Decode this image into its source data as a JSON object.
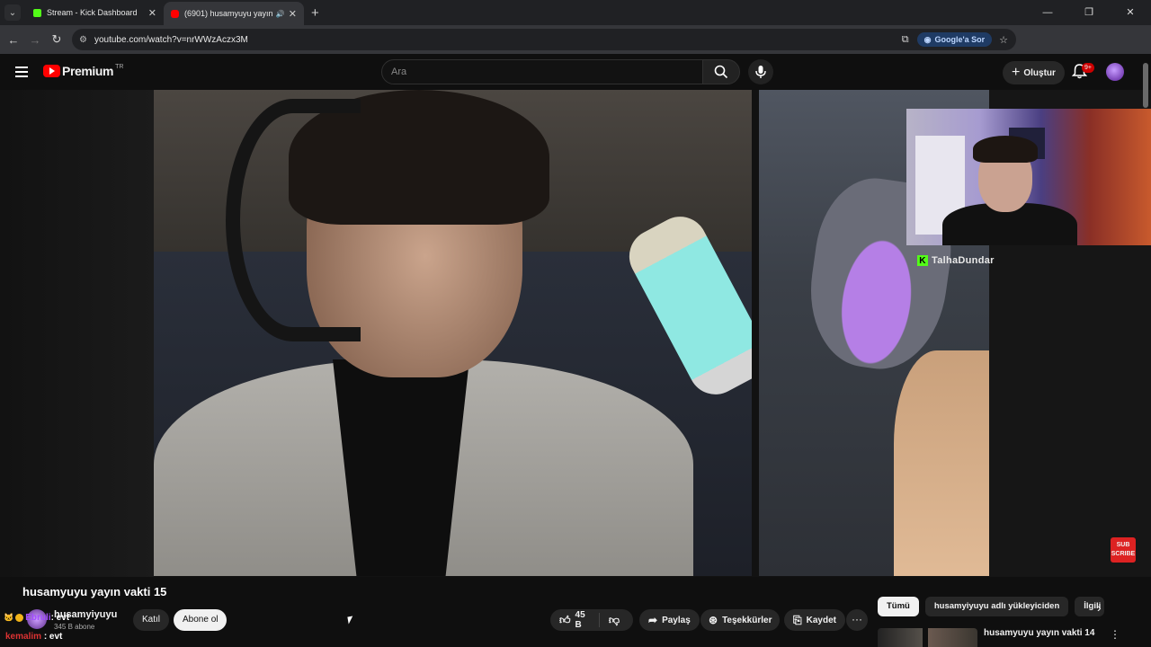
{
  "browser": {
    "tabs": [
      {
        "title": "Stream - Kick Dashboard",
        "favicon_color": "#53fc18"
      },
      {
        "title": "(6901) husamyuyu yayın vakti",
        "favicon_color": "#ff0000"
      }
    ],
    "new_tab": "+",
    "url": "youtube.com/watch?v=nrWWzAczx3M",
    "ask_google": "Google'a Sor",
    "profile_letter": "T"
  },
  "youtube": {
    "logo_text": "Premium",
    "country_code": "TR",
    "search_placeholder": "Ara",
    "create_label": "Oluştur",
    "notification_count": "9+"
  },
  "player": {
    "overlay_name": "TalhaDundar",
    "subscribe_button": "SUB SCRIBE"
  },
  "video": {
    "title": "husamyuyu yayın vakti 15",
    "channel_name": "husamyiyuyu",
    "subscribers": "345 B abone",
    "join_label": "Katıl",
    "subscribe_label": "Abone ol",
    "likes": "45 B",
    "share_label": "Paylaş",
    "thanks_label": "Teşekkürler",
    "save_label": "Kaydet"
  },
  "chat_overlay": [
    {
      "user": "Ebruli",
      "message": ": evt"
    },
    {
      "user": "kemalim",
      "message": ": evt"
    }
  ],
  "recommendations": {
    "chips": [
      "Tümü",
      "husamyiyuyu adlı yükleyiciden",
      "İlgili"
    ],
    "first_video_title": "husamyuyu yayın vakti 14"
  }
}
